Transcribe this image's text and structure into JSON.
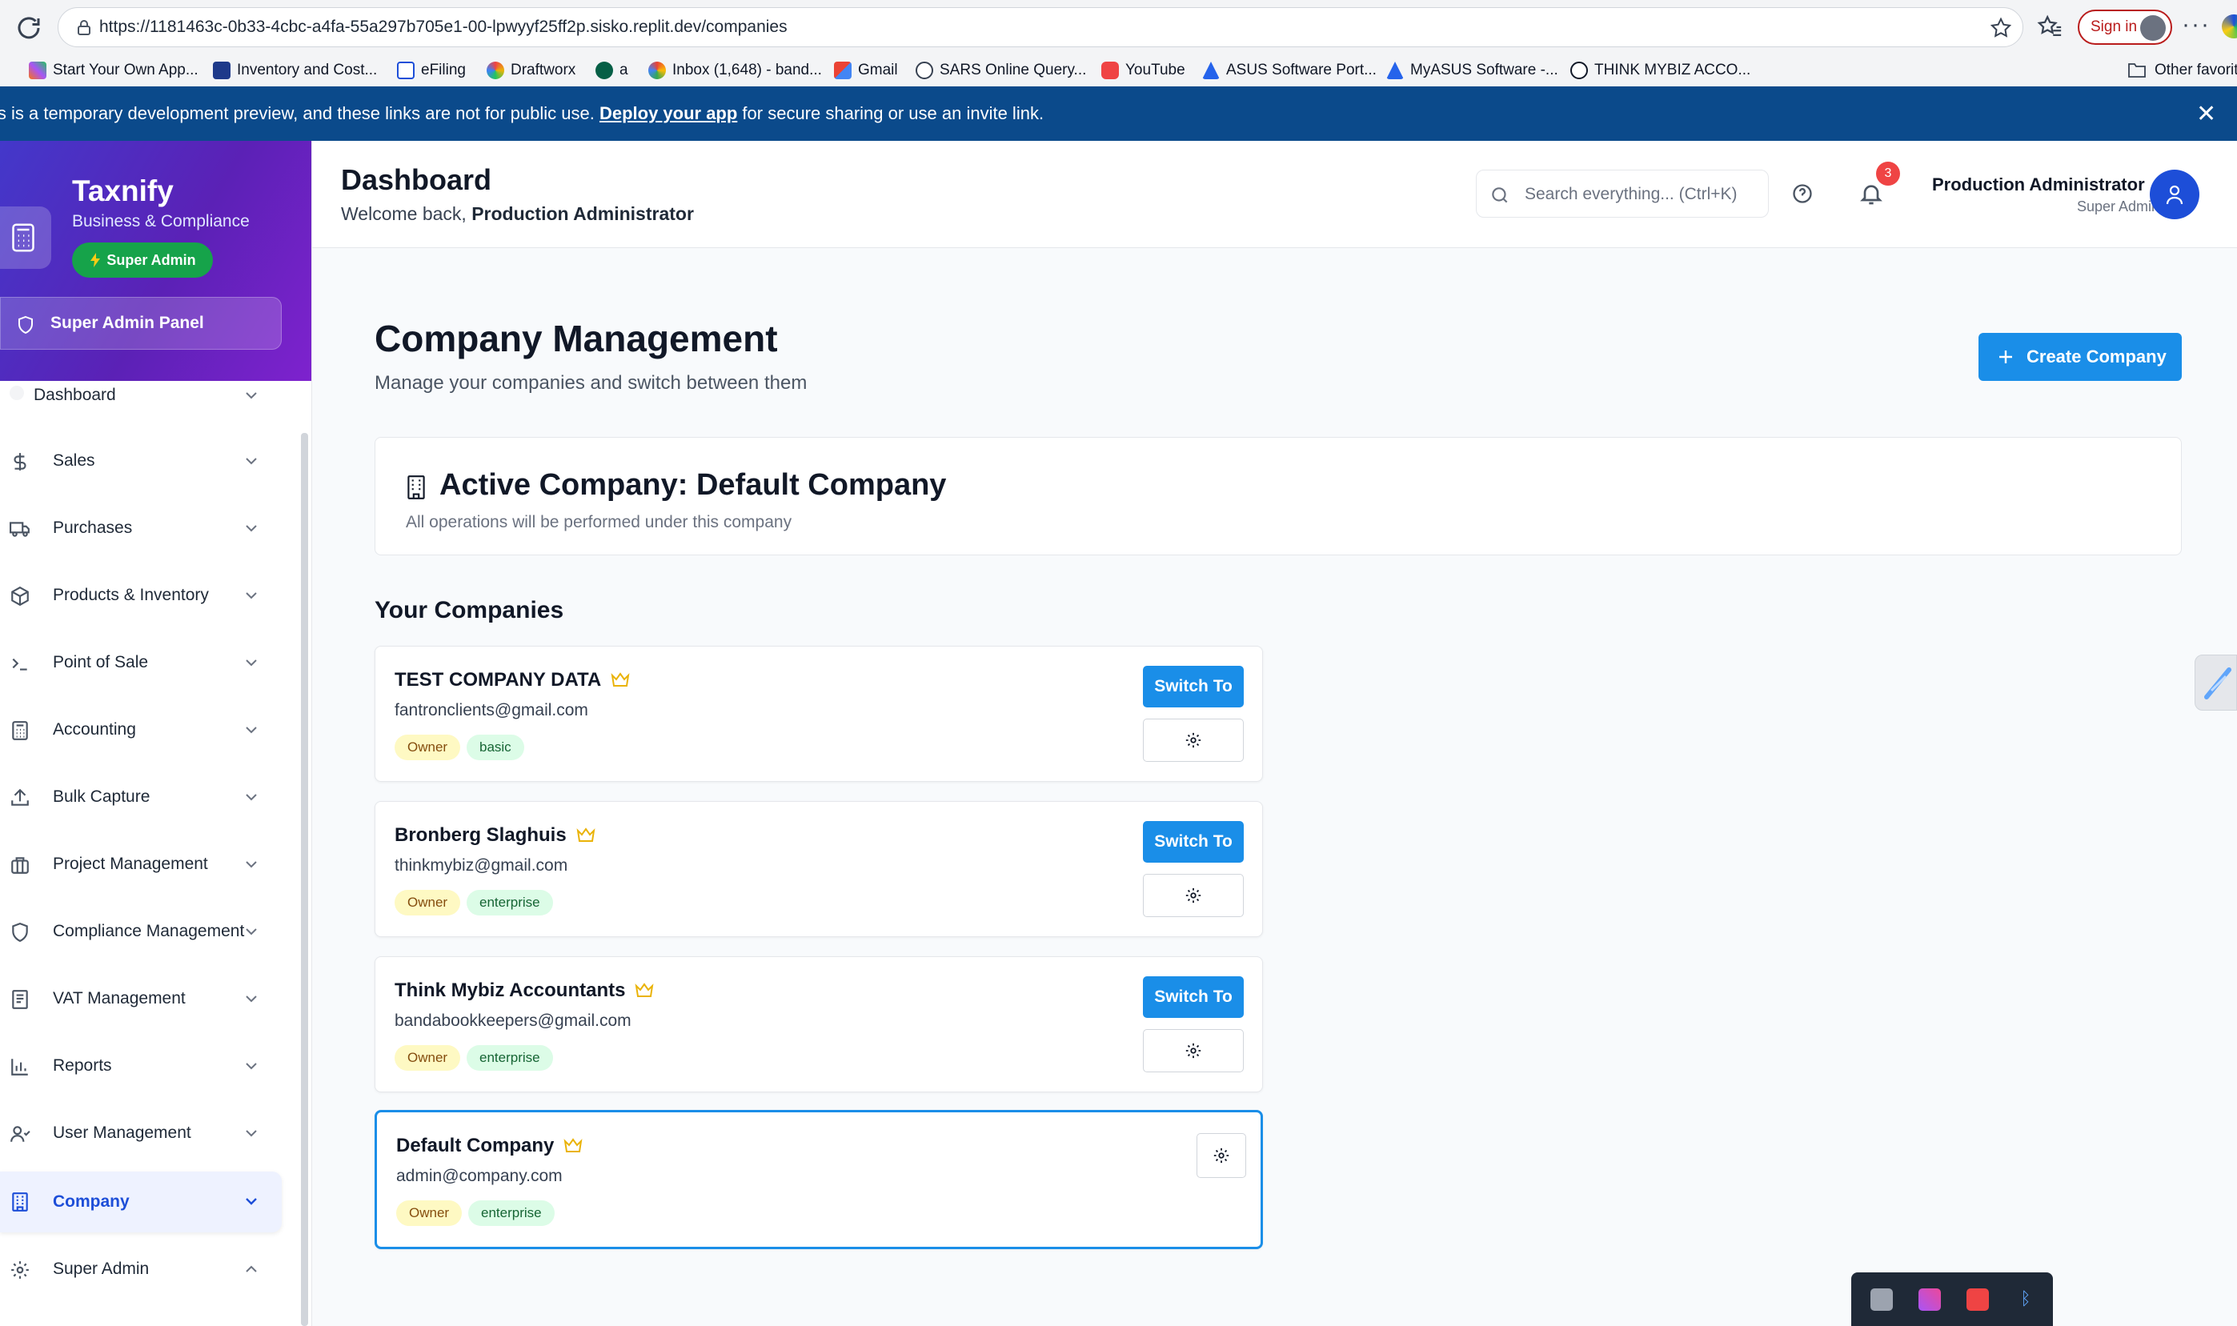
{
  "browser": {
    "url": "https://1181463c-0b33-4cbc-a4fa-55a297b705e1-00-lpwyyf25ff2p.sisko.replit.dev/companies",
    "sign_in": "Sign in",
    "other_favorites": "Other favorit",
    "bookmarks": [
      {
        "label": "Start Your Own App...",
        "icon": "rainbow-icon"
      },
      {
        "label": "Inventory and Cost...",
        "icon": "ac-icon"
      },
      {
        "label": "eFiling",
        "icon": "efiling-icon"
      },
      {
        "label": "Draftworx",
        "icon": "draftworx-icon"
      },
      {
        "label": "a",
        "icon": "a-icon"
      },
      {
        "label": "Inbox (1,648) - band...",
        "icon": "google-icon"
      },
      {
        "label": "Gmail",
        "icon": "gmail-icon"
      },
      {
        "label": "SARS Online Query...",
        "icon": "globe-icon"
      },
      {
        "label": "YouTube",
        "icon": "youtube-icon"
      },
      {
        "label": "ASUS Software Port...",
        "icon": "asus-icon"
      },
      {
        "label": "MyASUS Software -...",
        "icon": "asus-icon"
      },
      {
        "label": "THINK MYBIZ ACCO...",
        "icon": "thinkmybiz-icon"
      }
    ]
  },
  "banner": {
    "text_before": "is is a temporary development preview, and these links are not for public use. ",
    "link": "Deploy your app",
    "text_after": " for secure sharing or use an invite link.",
    "close": "✕"
  },
  "sidebar": {
    "brand": "Taxnify",
    "subtitle": "Business & Compliance",
    "badge": "Super Admin",
    "panel": "Super Admin Panel",
    "items": [
      {
        "label": "Dashboard",
        "icon": "dot-icon",
        "chevron": "down"
      },
      {
        "label": "Sales",
        "icon": "dollar-icon",
        "chevron": "down"
      },
      {
        "label": "Purchases",
        "icon": "truck-icon",
        "chevron": "down"
      },
      {
        "label": "Products & Inventory",
        "icon": "box-icon",
        "chevron": "down"
      },
      {
        "label": "Point of Sale",
        "icon": "terminal-icon",
        "chevron": "down"
      },
      {
        "label": "Accounting",
        "icon": "calculator-icon",
        "chevron": "down"
      },
      {
        "label": "Bulk Capture",
        "icon": "upload-icon",
        "chevron": "down"
      },
      {
        "label": "Project Management",
        "icon": "briefcase-icon",
        "chevron": "down"
      },
      {
        "label": "Compliance Management",
        "icon": "shield-icon",
        "chevron": "down"
      },
      {
        "label": "VAT Management",
        "icon": "receipt-icon",
        "chevron": "down"
      },
      {
        "label": "Reports",
        "icon": "bar-chart-icon",
        "chevron": "down"
      },
      {
        "label": "User Management",
        "icon": "users-icon",
        "chevron": "down"
      },
      {
        "label": "Company",
        "icon": "building-icon",
        "chevron": "down",
        "active": true
      },
      {
        "label": "Super Admin",
        "icon": "gear-icon",
        "chevron": "up"
      }
    ]
  },
  "header": {
    "title": "Dashboard",
    "welcome_prefix": "Welcome back, ",
    "welcome_name": "Production Administrator",
    "search_placeholder": "Search everything... (Ctrl+K)",
    "notification_count": "3",
    "user_name": "Production Administrator",
    "user_role": "Super Admin"
  },
  "main": {
    "title": "Company Management",
    "subtitle": "Manage your companies and switch between them",
    "create_button": "Create Company",
    "active_company_title": "Active Company: Default Company",
    "active_company_subtitle": "All operations will be performed under this company",
    "your_companies": "Your Companies",
    "switch_label": "Switch To",
    "companies": [
      {
        "name": "TEST COMPANY DATA",
        "email": "fantronclients@gmail.com",
        "role": "Owner",
        "plan": "basic",
        "active": false
      },
      {
        "name": "Bronberg Slaghuis",
        "email": "thinkmybiz@gmail.com",
        "role": "Owner",
        "plan": "enterprise",
        "active": false
      },
      {
        "name": "Think Mybiz Accountants",
        "email": "bandabookkeepers@gmail.com",
        "role": "Owner",
        "plan": "enterprise",
        "active": false
      },
      {
        "name": "Default Company",
        "email": "admin@company.com",
        "role": "Owner",
        "plan": "enterprise",
        "active": true
      }
    ]
  },
  "colors": {
    "primary": "#1a8ee8",
    "sidebar_gradient_start": "#4338ca",
    "sidebar_gradient_end": "#7e22ce",
    "banner": "#0b4a8b",
    "super_admin_badge": "#16a34a",
    "owner_tag": "#fef9c3",
    "plan_tag": "#dcfce7",
    "crown": "#eab308"
  }
}
